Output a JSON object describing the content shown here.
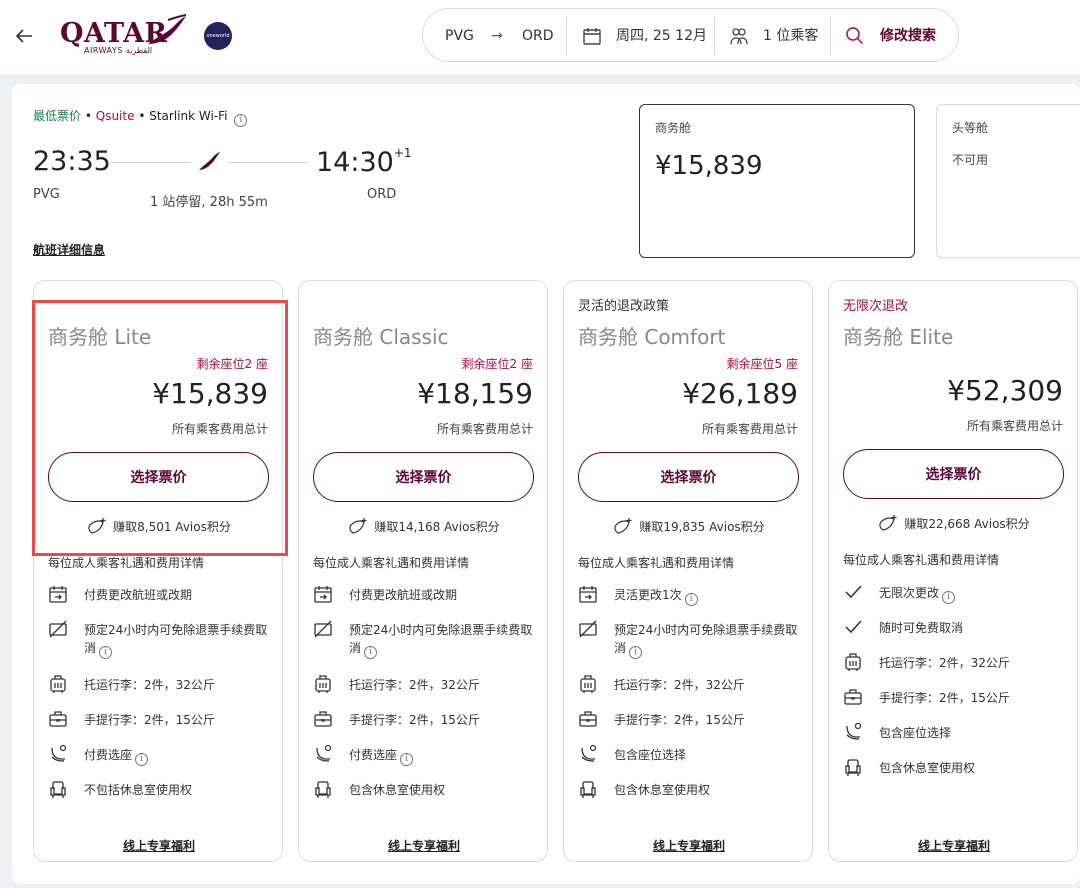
{
  "header": {
    "brand_name": "QATAR",
    "brand_sub": "AIRWAYS القطرية",
    "alliance_badge": "oneworld",
    "origin": "PVG",
    "arrow": "→",
    "destination": "ORD",
    "date": "周四, 25 12月",
    "passengers": "1 位乘客",
    "modify": "修改搜索",
    "icons": [
      "back-arrow-icon",
      "calendar-icon",
      "passengers-icon",
      "search-icon"
    ]
  },
  "flight": {
    "tag_lowest": "最低票价",
    "tag_suite": "Qsuite",
    "tag_wifi": "Starlink Wi-Fi",
    "dep_time": "23:35",
    "arr_time": "14:30",
    "arr_day": "+1",
    "dep_code": "PVG",
    "arr_code": "ORD",
    "stops": "1 站停留, 28h 55m",
    "details_link": "航班详细信息"
  },
  "cabins": [
    {
      "label": "商务舱",
      "price": "¥15,839"
    },
    {
      "label": "头等舱",
      "status": "不可用"
    }
  ],
  "perks_title": "每位成人乘客礼遇和费用详情",
  "exclusive_label": "线上专享福利",
  "select_label": "选择票价",
  "total_note": "所有乘客费用总计",
  "fares": [
    {
      "tag": "",
      "name": "商务舱 Lite",
      "seats": "剩余座位2 座",
      "price": "¥15,839",
      "avios": "赚取8,501 Avios积分",
      "perks": [
        {
          "icon": "calendar-change-icon",
          "text": "付费更改航班或改期"
        },
        {
          "icon": "no-refund-icon",
          "text": "预定24小时内可免除退票手续费取消"
        },
        {
          "icon": "checked-bag-icon",
          "text": "托运行李：2件，32公斤"
        },
        {
          "icon": "cabin-bag-icon",
          "text": "手提行李：2件，15公斤"
        },
        {
          "icon": "seat-icon",
          "text": "付费选座"
        },
        {
          "icon": "lounge-icon",
          "text": "不包括休息室使用权"
        }
      ]
    },
    {
      "tag": "",
      "name": "商务舱 Classic",
      "seats": "剩余座位2 座",
      "price": "¥18,159",
      "avios": "赚取14,168 Avios积分",
      "perks": [
        {
          "icon": "calendar-change-icon",
          "text": "付费更改航班或改期"
        },
        {
          "icon": "no-refund-icon",
          "text": "预定24小时内可免除退票手续费取消"
        },
        {
          "icon": "checked-bag-icon",
          "text": "托运行李：2件，32公斤"
        },
        {
          "icon": "cabin-bag-icon",
          "text": "手提行李：2件，15公斤"
        },
        {
          "icon": "seat-icon",
          "text": "付费选座"
        },
        {
          "icon": "lounge-icon",
          "text": "包含休息室使用权"
        }
      ]
    },
    {
      "tag": "灵活的退改政策",
      "name": "商务舱 Comfort",
      "seats": "剩余座位5 座",
      "price": "¥26,189",
      "avios": "赚取19,835 Avios积分",
      "perks": [
        {
          "icon": "calendar-change-icon",
          "text": "灵活更改1次"
        },
        {
          "icon": "no-refund-icon",
          "text": "预定24小时内可免除退票手续费取消"
        },
        {
          "icon": "checked-bag-icon",
          "text": "托运行李：2件，32公斤"
        },
        {
          "icon": "cabin-bag-icon",
          "text": "手提行李：2件，15公斤"
        },
        {
          "icon": "seat-icon",
          "text": "包含座位选择"
        },
        {
          "icon": "lounge-icon",
          "text": "包含休息室使用权"
        }
      ]
    },
    {
      "tag": "无限次退改",
      "name": "商务舱 Elite",
      "seats": "",
      "price": "¥52,309",
      "avios": "赚取22,668 Avios积分",
      "perks": [
        {
          "icon": "check-icon",
          "text": "无限次更改"
        },
        {
          "icon": "check-icon",
          "text": "随时可免费取消"
        },
        {
          "icon": "checked-bag-icon",
          "text": "托运行李：2件，32公斤"
        },
        {
          "icon": "cabin-bag-icon",
          "text": "手提行李：2件，15公斤"
        },
        {
          "icon": "seat-icon",
          "text": "包含座位选择"
        },
        {
          "icon": "lounge-icon",
          "text": "包含休息室使用权"
        }
      ]
    }
  ],
  "colors": {
    "brand": "#5c0632",
    "accent_red": "#a0114a",
    "green": "#1a7f4b",
    "highlight": "#e94a4a"
  }
}
